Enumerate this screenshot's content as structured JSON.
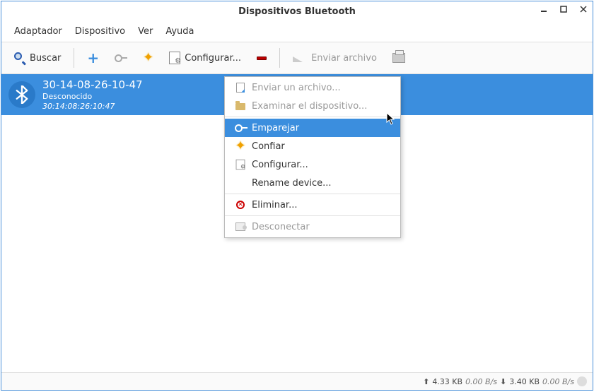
{
  "title": "Dispositivos Bluetooth",
  "menu": {
    "adapter": "Adaptador",
    "device": "Dispositivo",
    "view": "Ver",
    "help": "Ayuda"
  },
  "toolbar": {
    "search": "Buscar",
    "configure": "Configurar...",
    "sendfile": "Enviar archivo"
  },
  "device": {
    "name": "30-14-08-26-10-47",
    "subtitle": "Desconocido",
    "mac": "30:14:08:26:10:47"
  },
  "context": {
    "sendfile": "Enviar un archivo...",
    "browse": "Examinar el dispositivo...",
    "pair": "Emparejar",
    "trust": "Confiar",
    "setup": "Configurar...",
    "rename": "Rename device...",
    "remove": "Eliminar...",
    "disconnect": "Desconectar"
  },
  "status": {
    "up_total": "4.33 KB",
    "up_rate": "0.00 B/s",
    "dn_total": "3.40 KB",
    "dn_rate": "0.00 B/s"
  }
}
